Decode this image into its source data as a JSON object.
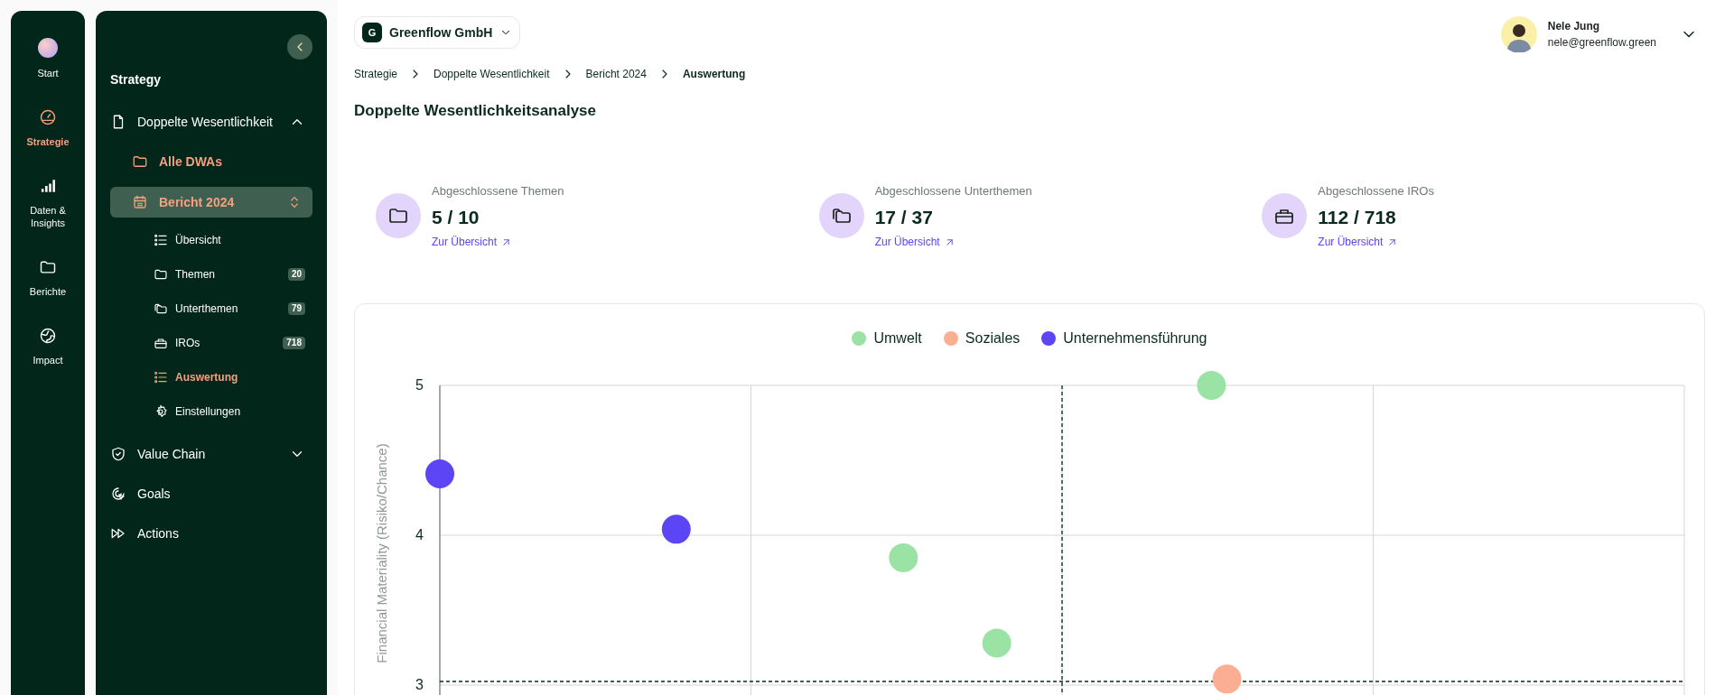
{
  "rail": [
    {
      "label": "Start",
      "selected": false
    },
    {
      "label": "Strategie",
      "selected": true
    },
    {
      "label": "Daten & Insights",
      "selected": false
    },
    {
      "label": "Berichte",
      "selected": false
    },
    {
      "label": "Impact",
      "selected": false
    }
  ],
  "sidebar": {
    "title": "Strategy",
    "items": [
      {
        "label": "Doppelte Wesentlichkeit",
        "expanded": true,
        "children": [
          {
            "kind": "link",
            "label": "Alle DWAs"
          },
          {
            "kind": "report",
            "label": "Bericht 2024",
            "selected": true,
            "children": [
              {
                "label": "Übersicht",
                "selected": false
              },
              {
                "label": "Themen",
                "badge": "20",
                "selected": false
              },
              {
                "label": "Unterthemen",
                "badge": "79",
                "selected": false
              },
              {
                "label": "IROs",
                "badge": "718",
                "selected": false
              },
              {
                "label": "Auswertung",
                "selected": true
              },
              {
                "label": "Einstellungen",
                "selected": false
              }
            ]
          }
        ]
      },
      {
        "label": "Value Chain",
        "expanded": false
      },
      {
        "label": "Goals"
      },
      {
        "label": "Actions"
      }
    ]
  },
  "company": {
    "initial": "G",
    "name": "Greenflow GmbH"
  },
  "user": {
    "name": "Nele Jung",
    "email": "nele@greenflow.green"
  },
  "breadcrumbs": [
    {
      "label": "Strategie",
      "current": false
    },
    {
      "label": "Doppelte Wesentlichkeit",
      "current": false
    },
    {
      "label": "Bericht 2024",
      "current": false
    },
    {
      "label": "Auswertung",
      "current": true
    }
  ],
  "page_title": "Doppelte Wesentlichkeitsanalyse",
  "stats": [
    {
      "label": "Abgeschlossene Themen",
      "value": "5 / 10",
      "link": "Zur Übersicht"
    },
    {
      "label": "Abgeschlossene Unterthemen",
      "value": "17 / 37",
      "link": "Zur Übersicht"
    },
    {
      "label": "Abgeschlossene IROs",
      "value": "112 / 718",
      "link": "Zur Übersicht"
    }
  ],
  "chart": {
    "legend": [
      {
        "name": "Umwelt",
        "color": "#9be3a4"
      },
      {
        "name": "Soziales",
        "color": "#fbae91"
      },
      {
        "name": "Unternehmensführung",
        "color": "#5b45f5"
      }
    ],
    "y_axis_title": "Financial Materiality (Risiko/Chance)",
    "y_tick_labels": [
      "5",
      "4",
      "3"
    ]
  }
}
